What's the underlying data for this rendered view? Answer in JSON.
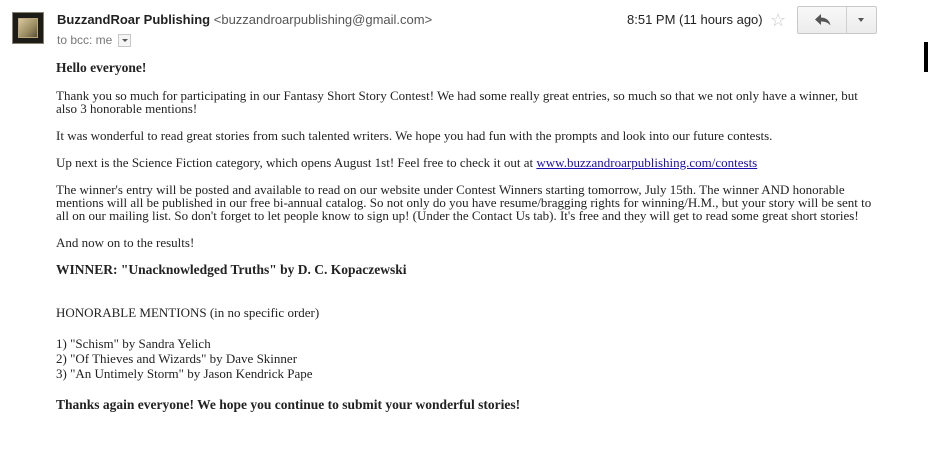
{
  "header": {
    "sender_name": "BuzzandRoar Publishing",
    "sender_email": "<buzzandroarpublishing@gmail.com>",
    "recipients": "to bcc: me",
    "date": "8:51 PM (11 hours ago)",
    "star_icon": "star-outline",
    "reply_icon": "reply-arrow",
    "more_icon": "chevron-down"
  },
  "body": {
    "greeting": "Hello everyone!",
    "paragraph_1": "Thank you so much for participating in our Fantasy Short Story Contest! We had some really great entries, so much so that we not only have a winner, but also 3 honorable mentions!",
    "paragraph_2": "It was wonderful to read great stories from such talented writers. We hope you had fun with the prompts and look into our future contests.",
    "paragraph_3_prefix": "Up next is the Science Fiction category, which opens August 1st! Feel free to check it out at ",
    "paragraph_3_link": "www.buzzandroarpublishing.com/contests",
    "paragraph_4": "The winner's entry will be posted and available to read on our website under Contest Winners starting tomorrow, July 15th. The winner AND honorable mentions will all be published in our free bi-annual catalog. So not only do you have resume/bragging rights for winning/H.M., but your story will be sent to all on our mailing list. So don't forget to let people know to sign up! (Under the Contact Us tab). It's free and they will get to read some great short stories!",
    "paragraph_5": "And now on to the results!",
    "winner": "WINNER: \"Unacknowledged Truths\" by D. C. Kopaczewski",
    "honorable_heading": "HONORABLE MENTIONS (in no specific order)",
    "mentions": [
      "1) \"Schism\" by Sandra Yelich",
      "2) \"Of Thieves and Wizards\" by Dave Skinner",
      "3) \"An Untimely Storm\" by Jason Kendrick Pape"
    ],
    "closing": "Thanks again everyone! We hope you continue to submit your wonderful stories!"
  },
  "colors": {
    "link": "#1a0dab",
    "text": "#222222",
    "muted": "#777777",
    "star": "#c8c8c8"
  }
}
